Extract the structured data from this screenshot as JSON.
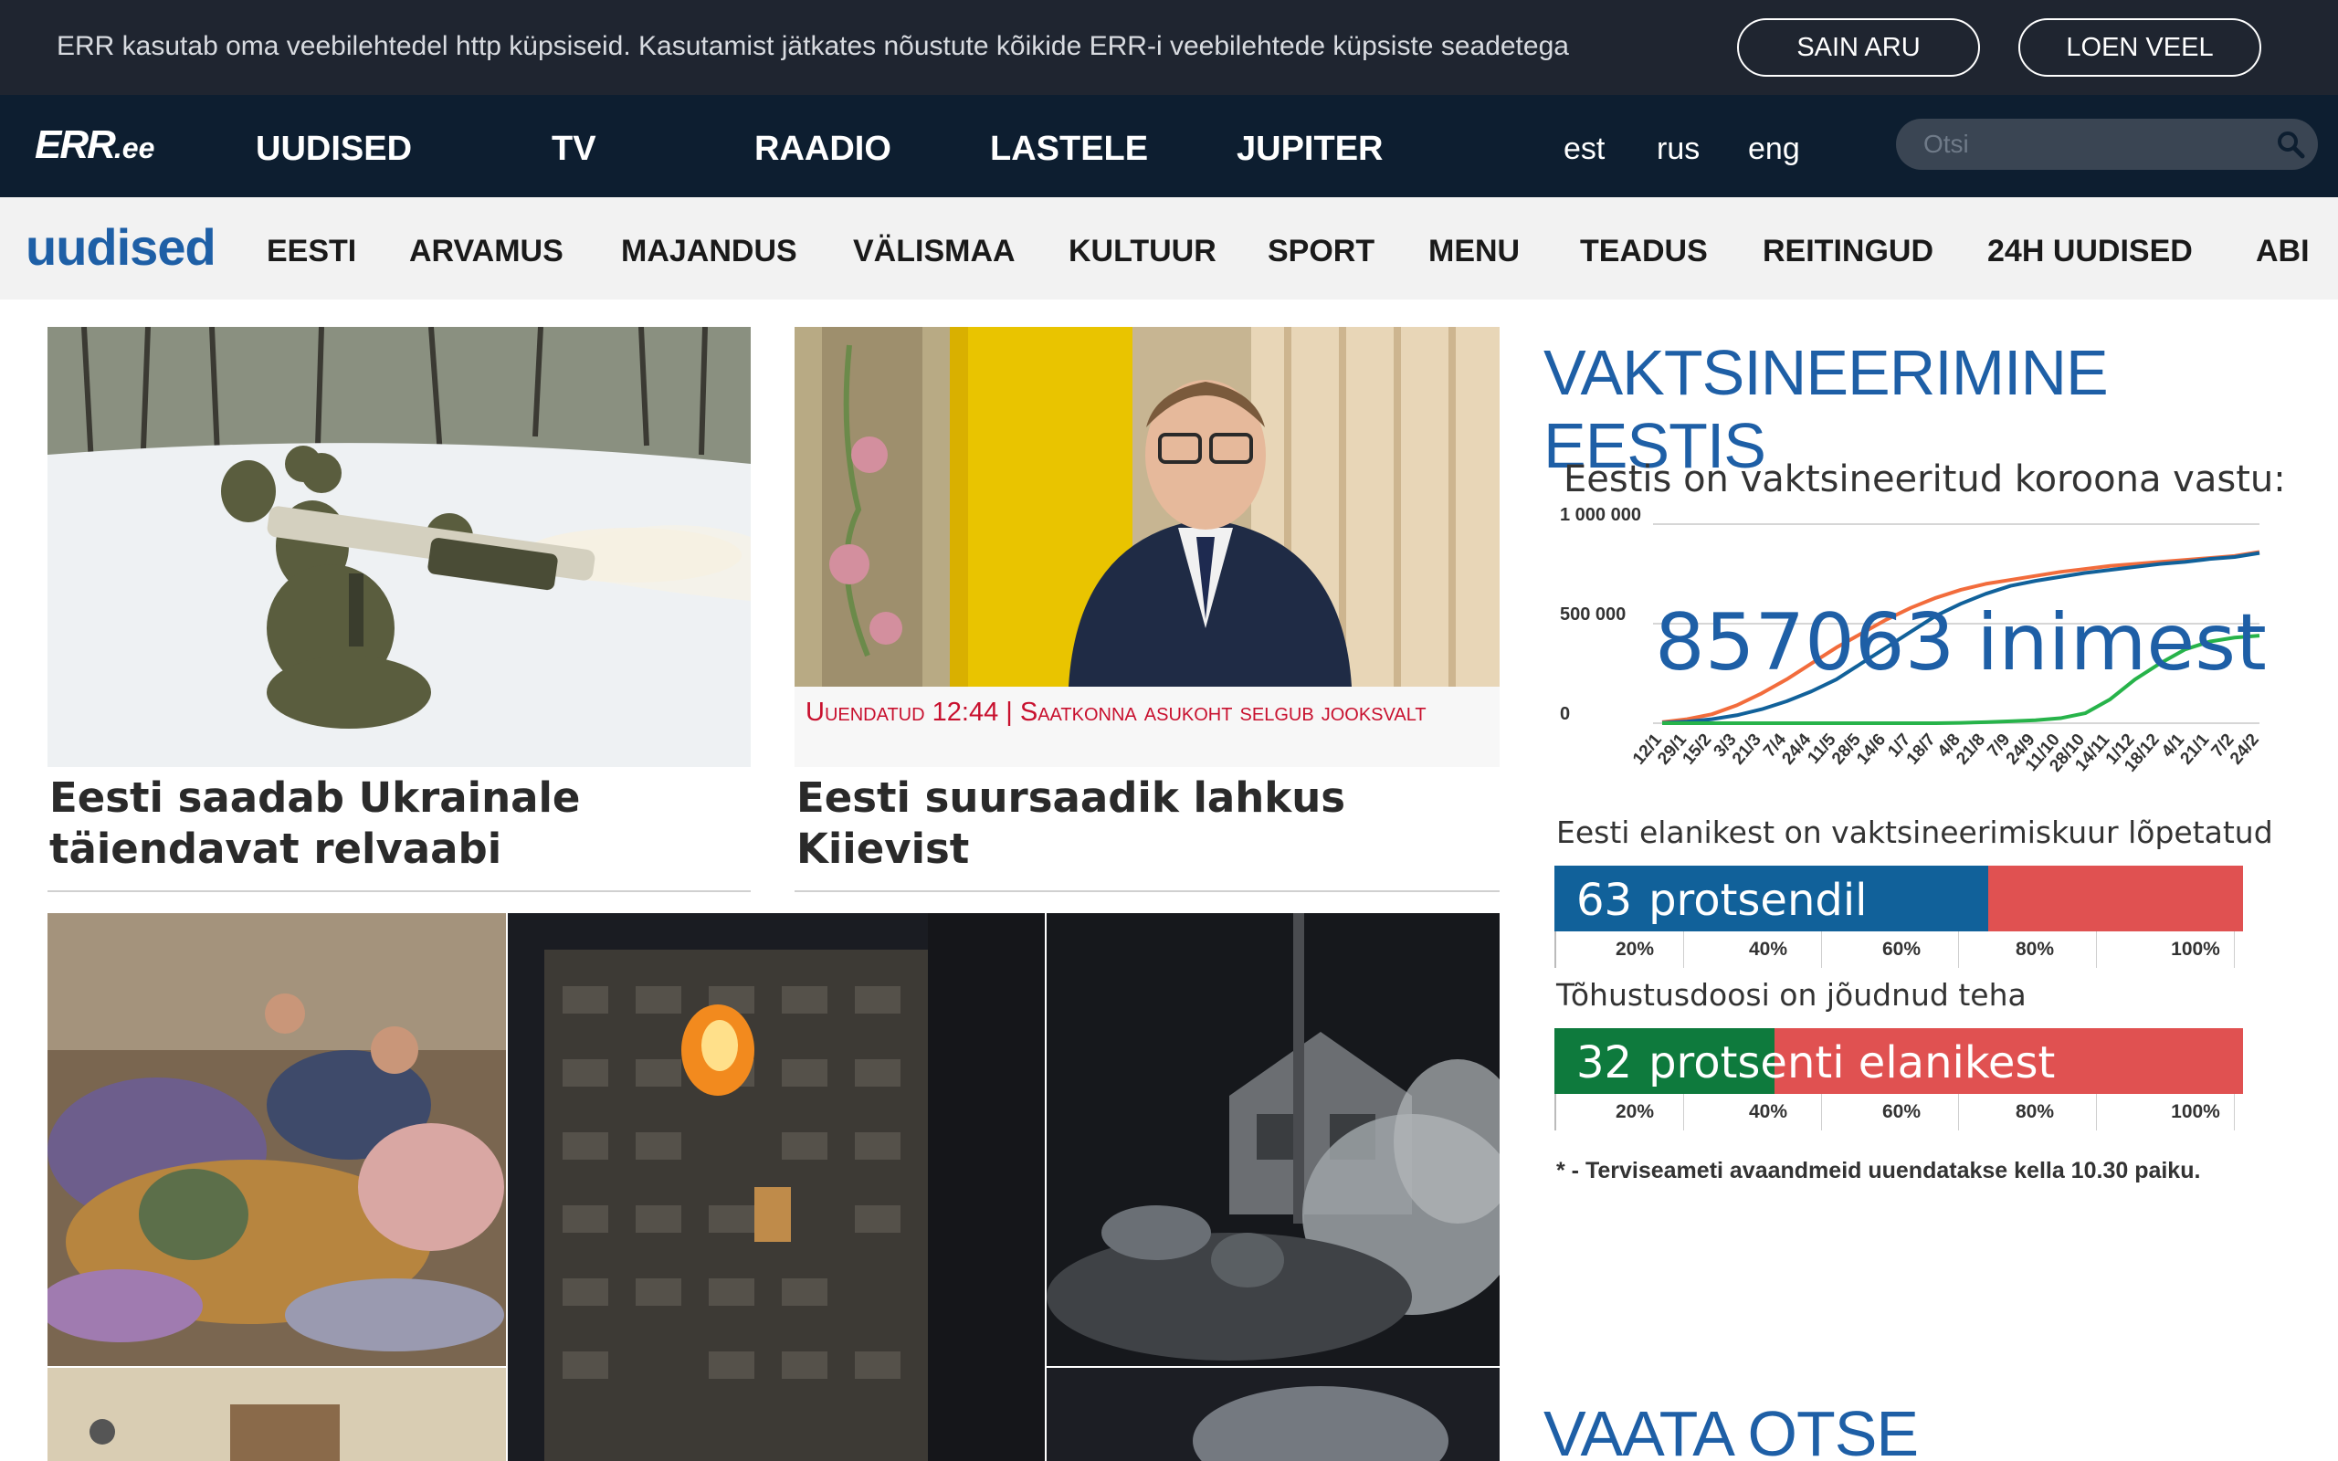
{
  "cookie": {
    "text": "ERR kasutab oma veebilehtedel http küpsiseid. Kasutamist jätkates nõustute kõikide ERR-i veebilehtede küpsiste seadetega",
    "agree_label": "SAIN ARU",
    "more_label": "LOEN VEEL"
  },
  "top_nav": {
    "logo": "ERR",
    "logo_tld": ".ee",
    "links": [
      "UUDISED",
      "TV",
      "RAADIO",
      "LASTELE",
      "JUPITER"
    ],
    "langs": [
      "est",
      "rus",
      "eng"
    ],
    "search_placeholder": "Otsi"
  },
  "section_nav": {
    "brand": "uudised",
    "links": [
      "EESTI",
      "ARVAMUS",
      "MAJANDUS",
      "VÄLISMAA",
      "KULTUUR",
      "SPORT",
      "MENU",
      "TEADUS",
      "REITINGUD",
      "24H UUDISED",
      "ABI"
    ]
  },
  "articles": [
    {
      "title": "Eesti saadab Ukrainale täiendavat relvaabi"
    },
    {
      "update": "Uuendatud 12:44 | Saatkonna asukoht selgub jooksvalt",
      "title": "Eesti suursaadik lahkus Kiievist"
    }
  ],
  "sidebar": {
    "title": "VAKTSINEERIMINE EESTIS",
    "heading": "Eestis on vaktsineeritud koroona vastu:",
    "count": "857063",
    "count_unit": "inimest",
    "completed_heading": "Eesti elanikest on vaktsineerimiskuur lõpetatud",
    "completed_value": "63",
    "completed_unit": "protsendil",
    "booster_heading": "Tõhustusdoosi on jõudnud teha",
    "booster_value": "32",
    "booster_unit": "protsenti elanikest",
    "footnote": "* - Terviseameti avaandmeid uuendatakse kella 10.30 paiku.",
    "live_title": "VAATA OTSE"
  },
  "colors": {
    "cookie_bg": "#1f2530",
    "nav_bg": "#0d1e30",
    "brand_blue": "#1e5fa6",
    "bar_blue": "#11619a",
    "bar_green": "#0e7a3d",
    "bar_red": "#e05151",
    "line_orange": "#f26c3c",
    "line_blue": "#11619a",
    "line_green": "#27b34a"
  },
  "chart_data": [
    {
      "type": "line",
      "title": "Eestis on vaktsineeritud koroona vastu:",
      "x": [
        "12/1",
        "29/1",
        "15/2",
        "3/3",
        "21/3",
        "7/4",
        "24/4",
        "11/5",
        "28/5",
        "14/6",
        "1/7",
        "18/7",
        "4/8",
        "21/8",
        "7/9",
        "24/9",
        "11/10",
        "28/10",
        "14/11",
        "1/12",
        "18/12",
        "4/1",
        "21/1",
        "7/2",
        "24/2"
      ],
      "ylim": [
        0,
        1000000
      ],
      "yticks": [
        "0",
        "500 000",
        "1 000 000"
      ],
      "series": [
        {
          "color": "#f26c3c",
          "values": [
            5000,
            20000,
            45000,
            90000,
            150000,
            220000,
            300000,
            380000,
            450000,
            520000,
            580000,
            630000,
            670000,
            700000,
            720000,
            740000,
            760000,
            775000,
            790000,
            800000,
            810000,
            820000,
            830000,
            840000,
            860000
          ]
        },
        {
          "color": "#11619a",
          "values": [
            2000,
            8000,
            20000,
            40000,
            70000,
            110000,
            160000,
            220000,
            300000,
            380000,
            460000,
            540000,
            600000,
            650000,
            690000,
            715000,
            735000,
            755000,
            770000,
            785000,
            800000,
            810000,
            825000,
            835000,
            855000
          ]
        },
        {
          "color": "#27b34a",
          "values": [
            0,
            0,
            0,
            0,
            0,
            0,
            0,
            0,
            0,
            0,
            0,
            0,
            2000,
            5000,
            10000,
            15000,
            25000,
            50000,
            120000,
            220000,
            300000,
            370000,
            410000,
            430000,
            440000
          ]
        }
      ]
    },
    {
      "type": "bar",
      "title": "Eesti elanikest on vaktsineerimiskuur lõpetatud",
      "values": [
        63
      ],
      "xticks": [
        "20%",
        "40%",
        "60%",
        "80%",
        "100%"
      ],
      "xlim": [
        0,
        100
      ]
    },
    {
      "type": "bar",
      "title": "Tõhustusdoosi on jõudnud teha",
      "values": [
        32
      ],
      "xticks": [
        "20%",
        "40%",
        "60%",
        "80%",
        "100%"
      ],
      "xlim": [
        0,
        100
      ]
    }
  ]
}
